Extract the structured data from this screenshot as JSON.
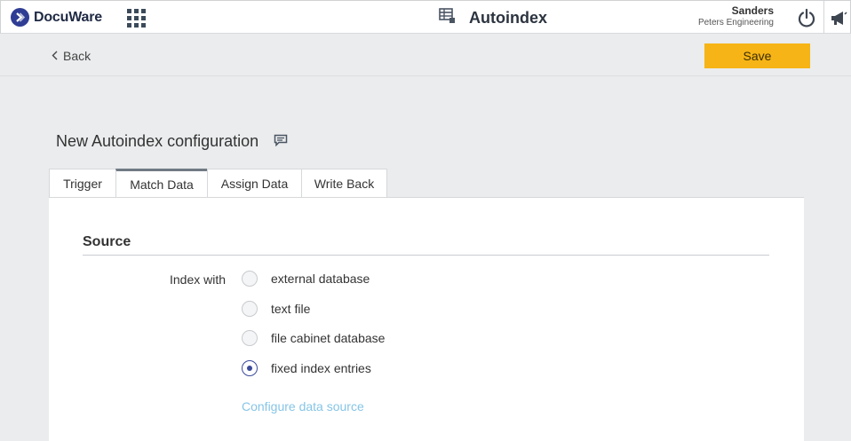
{
  "header": {
    "brand": "DocuWare",
    "app_title": "Autoindex",
    "user_name": "Sanders",
    "user_org": "Peters Engineering"
  },
  "toolbar": {
    "back_label": "Back",
    "save_label": "Save"
  },
  "page": {
    "config_title": "New Autoindex configuration"
  },
  "tabs": [
    {
      "label": "Trigger",
      "active": false
    },
    {
      "label": "Match Data",
      "active": true
    },
    {
      "label": "Assign Data",
      "active": false
    },
    {
      "label": "Write Back",
      "active": false
    }
  ],
  "source": {
    "section_title": "Source",
    "index_with_label": "Index with",
    "options": [
      {
        "label": "external database",
        "checked": false
      },
      {
        "label": "text file",
        "checked": false
      },
      {
        "label": "file cabinet database",
        "checked": false
      },
      {
        "label": "fixed index entries",
        "checked": true
      }
    ],
    "configure_link": "Configure data source"
  },
  "colors": {
    "brand": "#2f3d94",
    "save_button": "#f6b416",
    "link": "#86c5e6"
  },
  "icons": [
    "docuware-logo-icon",
    "app-grid-icon",
    "autoindex-table-icon",
    "power-icon",
    "megaphone-icon",
    "chevron-left-icon",
    "comment-icon"
  ]
}
